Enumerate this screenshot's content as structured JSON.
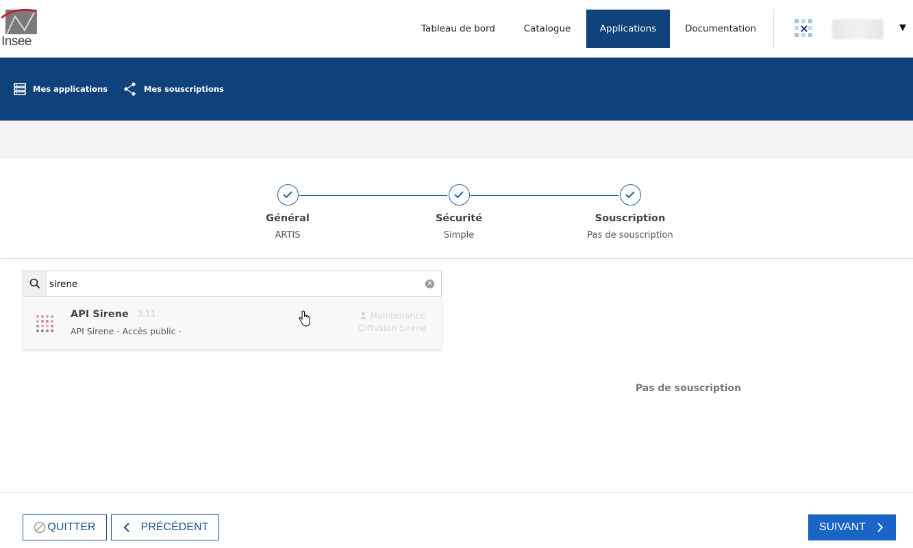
{
  "header": {
    "logo_text": "Insee",
    "nav": [
      {
        "label": "Tableau de bord",
        "active": false
      },
      {
        "label": "Catalogue",
        "active": false
      },
      {
        "label": "Applications",
        "active": true
      },
      {
        "label": "Documentation",
        "active": false
      }
    ],
    "accent_color": "#0f427a"
  },
  "subnav": {
    "items": [
      {
        "label": "Mes applications",
        "icon": "server-icon"
      },
      {
        "label": "Mes souscriptions",
        "icon": "share-icon"
      }
    ]
  },
  "stepper": {
    "steps": [
      {
        "title": "Général",
        "subtitle": "ARTIS",
        "done": true
      },
      {
        "title": "Sécurité",
        "subtitle": "Simple",
        "done": true
      },
      {
        "title": "Souscription",
        "subtitle": "Pas de souscription",
        "done": true
      }
    ]
  },
  "search": {
    "value": "sirene"
  },
  "results": [
    {
      "name": "API Sirene",
      "version": "3.11",
      "description": "API Sirene - Accès public -",
      "owner": "Maintenance Diffusion Sirene",
      "icon": "api-grid-icon"
    }
  ],
  "subscriptions": {
    "empty_label": "Pas de souscription"
  },
  "footer": {
    "quit_label": "QUITTER",
    "previous_label": "PRÉCÉDENT",
    "next_label": "SUIVANT",
    "primary_color": "#1a64c7"
  }
}
